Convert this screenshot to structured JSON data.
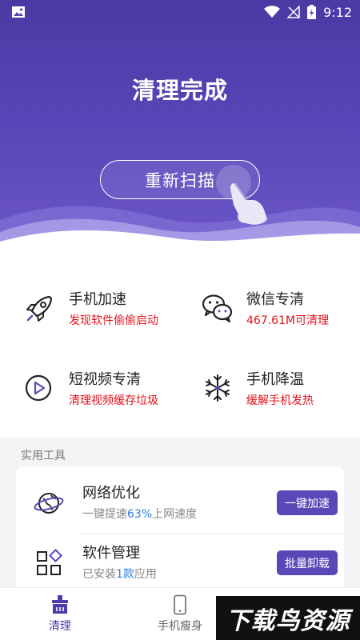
{
  "status_bar": {
    "time": "9:12"
  },
  "hero": {
    "title": "清理完成",
    "rescan_label": "重新扫描"
  },
  "features": [
    {
      "title": "手机加速",
      "subtitle": "发现软件偷偷启动",
      "icon": "rocket-icon"
    },
    {
      "title": "微信专清",
      "subtitle": "467.61M可清理",
      "icon": "wechat-icon"
    },
    {
      "title": "短视频专清",
      "subtitle": "清理视频缓存垃圾",
      "icon": "video-play-icon"
    },
    {
      "title": "手机降温",
      "subtitle": "缓解手机发热",
      "icon": "snowflake-icon"
    }
  ],
  "tools_section": {
    "label": "实用工具",
    "items": [
      {
        "title": "网络优化",
        "sub_prefix": "一键提速",
        "sub_highlight": "63%",
        "sub_suffix": "上网速度",
        "button": "一键加速",
        "icon": "globe-icon"
      },
      {
        "title": "软件管理",
        "sub_prefix": "已安装",
        "sub_highlight": "1款",
        "sub_suffix": "应用",
        "button": "批量卸载",
        "icon": "apps-grid-icon"
      }
    ]
  },
  "bottom_nav": {
    "items": [
      {
        "label": "清理",
        "icon": "broom-icon",
        "active": true
      },
      {
        "label": "手机瘦身",
        "icon": "phone-icon",
        "active": false
      }
    ]
  },
  "watermark": {
    "text": "下载鸟资源"
  },
  "colors": {
    "primary": "#5a48b8",
    "hero_top": "#4a3aa3",
    "alert_red": "#e2111a",
    "highlight_blue": "#2b7de1"
  }
}
